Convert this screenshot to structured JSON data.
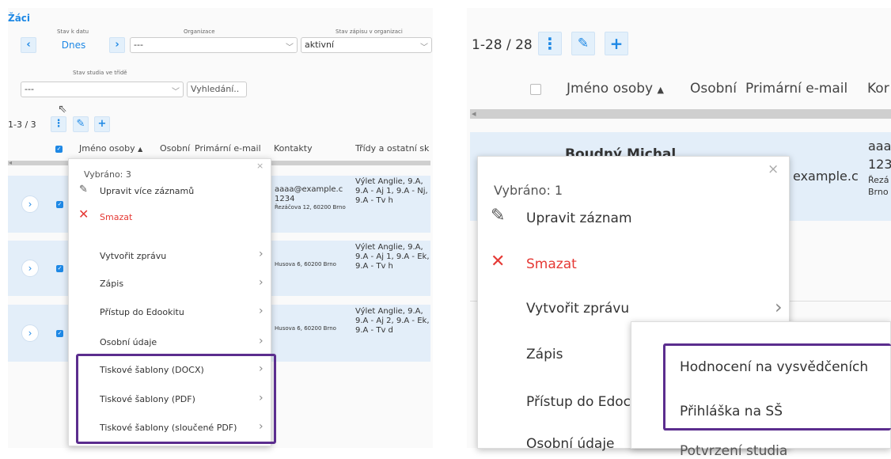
{
  "left": {
    "title": "Žáci",
    "labels": {
      "stav_k_datu": "Stav k datu",
      "organizace": "Organizace",
      "stav_zapisu": "Stav zápisu v organizaci",
      "stav_studia": "Stav studia ve třídě"
    },
    "date_value": "Dnes",
    "org_value": "---",
    "stav_zapisu_value": "aktivní",
    "stav_studia_value": "---",
    "search_button": "Vyhledání..",
    "count": "1-3 / 3",
    "columns": [
      "Jméno osoby",
      "Osobní",
      "Primární e-mail",
      "Kontakty",
      "Třídy a ostatní sk"
    ],
    "rows": [
      {
        "contact_main": "aaaa@example.c",
        "contact_phone": "1234",
        "address": "Řezáčova 12, 60200 Brno",
        "classes": "Výlet Anglie, 9.A, 9.A - Aj 1, 9.A - Nj, 9.A - Tv h"
      },
      {
        "contact_main": "",
        "contact_phone": "",
        "address": "Husova 6, 60200 Brno",
        "classes": "Výlet Anglie, 9.A, 9.A - Aj 1, 9.A - Ek, 9.A - Tv h"
      },
      {
        "contact_main": "",
        "contact_phone": "",
        "address": "Husova 6, 60200 Brno",
        "classes": "Výlet Anglie, 9.A, 9.A - Aj 2, 9.A - Ek, 9.A - Tv d"
      }
    ],
    "menu": {
      "selected": "Vybráno: 3",
      "items": [
        "Upravit více záznamů",
        "Smazat",
        "Vytvořit zprávu",
        "Zápis",
        "Přístup do Edookitu",
        "Osobní údaje",
        "Tiskové šablony (DOCX)",
        "Tiskové šablony (PDF)",
        "Tiskové šablony (sloučené PDF)"
      ]
    }
  },
  "right": {
    "count": "1-28 / 28",
    "columns": [
      "Jméno osoby",
      "Osobní",
      "Primární e-mail",
      "Kor"
    ],
    "row_name_partial": "Boudný Michal",
    "email_partial": "example.c",
    "contact_partial": "aaa",
    "phone_partial": "123",
    "addr_partial1": "Řezá",
    "addr_partial2": "Brno",
    "menu": {
      "selected": "Vybráno: 1",
      "items": [
        "Upravit záznam",
        "Smazat",
        "Vytvořit zprávu",
        "Zápis",
        "Přístup do Edoc",
        "Osobní údaje"
      ]
    },
    "submenu": {
      "items": [
        "Hodnocení na vysvědčeních",
        "Přihláška na SŠ",
        "Potvrzení studia"
      ]
    }
  },
  "colors": {
    "accent": "#1e88e5",
    "danger": "#e53935",
    "highlight": "#5b2d8e",
    "row_bg": "#e3eef9"
  },
  "icons": [
    "more-vertical-icon",
    "pencil-icon",
    "plus-icon",
    "chevron-left-icon",
    "chevron-right-icon",
    "chevron-down-icon",
    "close-icon",
    "checkbox-icon",
    "sort-up-icon",
    "cursor-icon"
  ]
}
